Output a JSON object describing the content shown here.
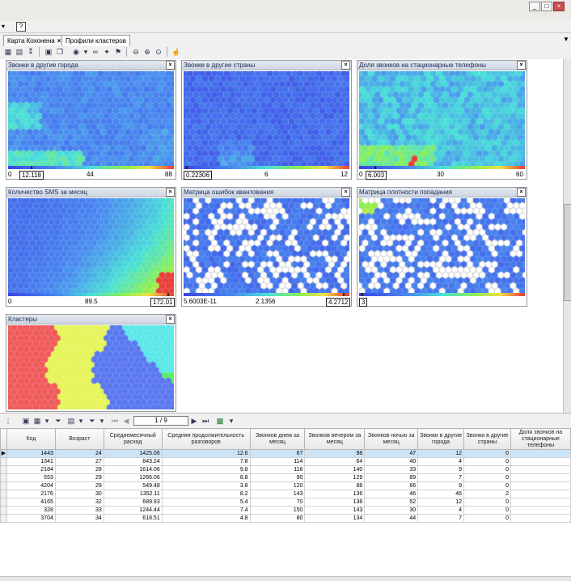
{
  "window": {
    "min_glyph": "_",
    "max_glyph": "□",
    "close_glyph": "×"
  },
  "menubar": {
    "help_glyph": "?"
  },
  "tabs": [
    {
      "label": "Карта Кохонена",
      "close": "×"
    },
    {
      "label": "Профили кластеров",
      "close": ""
    }
  ],
  "tabbar": {
    "dropdown_glyph": "▼"
  },
  "panels": [
    {
      "title": "Звонки в другие города",
      "scale": [
        "0",
        "12.118",
        "44",
        "88"
      ],
      "marker": 0.14
    },
    {
      "title": "Звонки в другие страны",
      "scale": [
        "0.22306",
        "6",
        "12"
      ],
      "marker": 0.02
    },
    {
      "title": "Доля звонков на стационарные телефоны",
      "scale": [
        "0",
        "6.003",
        "30",
        "60"
      ],
      "marker": 0.1
    },
    {
      "title": "Количество SMS за месяц",
      "scale": [
        "0",
        "89.5",
        "172.01"
      ],
      "marker": 0.97
    },
    {
      "title": "Матрица ошибок квантования",
      "scale": [
        "5.6003E-11",
        "2.1356",
        "4.2712"
      ],
      "marker": 0.97
    },
    {
      "title": "Матрица плотности попадания",
      "scale": [
        "3"
      ],
      "marker": 0.02
    },
    {
      "title": "Кластеры",
      "scale": [],
      "marker": 0
    }
  ],
  "panel_close_glyph": "×",
  "colors": {
    "som_low": "#4a5ae8",
    "som_mid": "#4ad6d0",
    "som_high": "#e84a3c",
    "cluster_red": "#f05a5a",
    "cluster_yellow": "#e6f55a",
    "cluster_blue": "#5a78f0",
    "cluster_cyan": "#5ae8e8",
    "cluster_green": "#5af05a",
    "selection": "#cde4f7"
  },
  "grid_toolbar": {
    "pager": "1 / 9"
  },
  "table": {
    "columns": [
      "Код",
      "Возраст",
      "Среднемесячный расход",
      "Средняя продолжительность разговоров",
      "Звонков днем за месяц",
      "Звонков вечером за месяц",
      "Звонков ночью за месяц",
      "Звонки в другие города",
      "Звонки в другие страны",
      "Доля звонков на стационарные телефоны"
    ],
    "rows": [
      [
        "1443",
        "24",
        "1425.06",
        "12.6",
        "67",
        "98",
        "47",
        "12",
        "0"
      ],
      [
        "1341",
        "27",
        "843.24",
        "7.8",
        "114",
        "64",
        "40",
        "4",
        "0"
      ],
      [
        "2184",
        "28",
        "1614.06",
        "9.8",
        "118",
        "140",
        "33",
        "9",
        "0"
      ],
      [
        "553",
        "29",
        "1266.06",
        "8.8",
        "90",
        "129",
        "89",
        "7",
        "0"
      ],
      [
        "4204",
        "29",
        "549.48",
        "3.8",
        "120",
        "88",
        "66",
        "9",
        "0"
      ],
      [
        "2176",
        "30",
        "1352.11",
        "8.2",
        "143",
        "136",
        "46",
        "46",
        "2"
      ],
      [
        "4165",
        "32",
        "689.93",
        "5.4",
        "70",
        "138",
        "52",
        "12",
        "0"
      ],
      [
        "328",
        "33",
        "1244.44",
        "7.4",
        "150",
        "143",
        "30",
        "4",
        "0"
      ],
      [
        "3704",
        "34",
        "618.51",
        "4.8",
        "80",
        "134",
        "44",
        "7",
        "0"
      ]
    ],
    "selected_row": 0,
    "row_indicator": "▶"
  }
}
